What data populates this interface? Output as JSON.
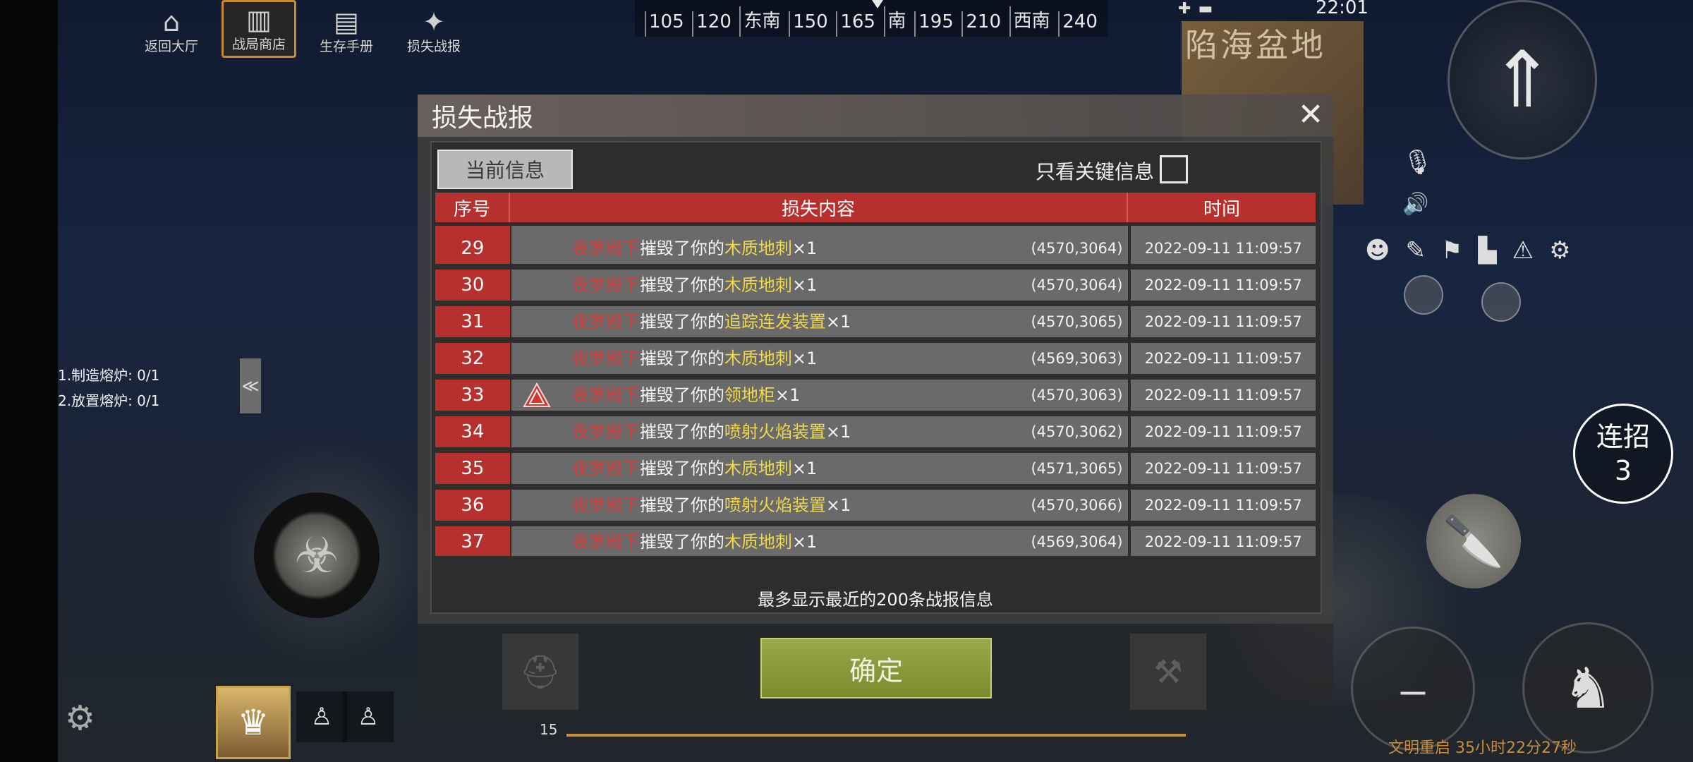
{
  "top_menu": [
    {
      "label": "返回大厅",
      "icon": "home-icon",
      "glyph": "⌂"
    },
    {
      "label": "战局商店",
      "icon": "shop-icon",
      "glyph": "▥"
    },
    {
      "label": "生存手册",
      "icon": "handbook-icon",
      "glyph": "▤"
    },
    {
      "label": "损失战报",
      "icon": "loss-report-icon",
      "glyph": "✦"
    }
  ],
  "compass": [
    "105",
    "120",
    "东南",
    "150",
    "165",
    "南",
    "195",
    "210",
    "西南",
    "240"
  ],
  "status": {
    "time": "22:01"
  },
  "minimap": {
    "title": "陷海盆地"
  },
  "quests": [
    "1.制造熔炉: 0/1",
    "2.放置熔炉: 0/1"
  ],
  "combo": {
    "label": "连招",
    "count": "3"
  },
  "bottom": {
    "level": "15",
    "restart_text": "文明重启 35小时22分27秒"
  },
  "dialog": {
    "title": "损失战报",
    "tab_current": "当前信息",
    "filter_label": "只看关键信息",
    "filter_checked": false,
    "headers": [
      "序号",
      "损失内容",
      "时间"
    ],
    "hint": "最多显示最近的200条战报信息",
    "confirm_label": "确定"
  },
  "loss_rows": [
    {
      "no": "29",
      "attacker": "夜罗殿下",
      "verb": "摧毁了你的",
      "item": "木质地刺",
      "qty": "×1",
      "coord": "(4570,3064)",
      "time": "2022-09-11 11:09:57",
      "warning": false
    },
    {
      "no": "30",
      "attacker": "夜罗殿下",
      "verb": "摧毁了你的",
      "item": "木质地刺",
      "qty": "×1",
      "coord": "(4570,3064)",
      "time": "2022-09-11 11:09:57",
      "warning": false
    },
    {
      "no": "31",
      "attacker": "夜罗殿下",
      "verb": "摧毁了你的",
      "item": "追踪连发装置",
      "qty": "×1",
      "coord": "(4570,3065)",
      "time": "2022-09-11 11:09:57",
      "warning": false
    },
    {
      "no": "32",
      "attacker": "夜罗殿下",
      "verb": "摧毁了你的",
      "item": "木质地刺",
      "qty": "×1",
      "coord": "(4569,3063)",
      "time": "2022-09-11 11:09:57",
      "warning": false
    },
    {
      "no": "33",
      "attacker": "夜罗殿下",
      "verb": "摧毁了你的",
      "item": "领地柜",
      "qty": "×1",
      "coord": "(4570,3063)",
      "time": "2022-09-11 11:09:57",
      "warning": true
    },
    {
      "no": "34",
      "attacker": "夜罗殿下",
      "verb": "摧毁了你的",
      "item": "喷射火焰装置",
      "qty": "×1",
      "coord": "(4570,3062)",
      "time": "2022-09-11 11:09:57",
      "warning": false
    },
    {
      "no": "35",
      "attacker": "夜罗殿下",
      "verb": "摧毁了你的",
      "item": "木质地刺",
      "qty": "×1",
      "coord": "(4571,3065)",
      "time": "2022-09-11 11:09:57",
      "warning": false
    },
    {
      "no": "36",
      "attacker": "夜罗殿下",
      "verb": "摧毁了你的",
      "item": "喷射火焰装置",
      "qty": "×1",
      "coord": "(4570,3066)",
      "time": "2022-09-11 11:09:57",
      "warning": false
    },
    {
      "no": "37",
      "attacker": "夜罗殿下",
      "verb": "摧毁了你的",
      "item": "木质地刺",
      "qty": "×1",
      "coord": "(4569,3064)",
      "time": "2022-09-11 11:09:57",
      "warning": false
    }
  ],
  "colors": {
    "header_red": "#b6302d",
    "attacker_red": "#d33a3a",
    "item_yellow": "#f0d84b",
    "confirm_green": "#8e9d3e"
  }
}
